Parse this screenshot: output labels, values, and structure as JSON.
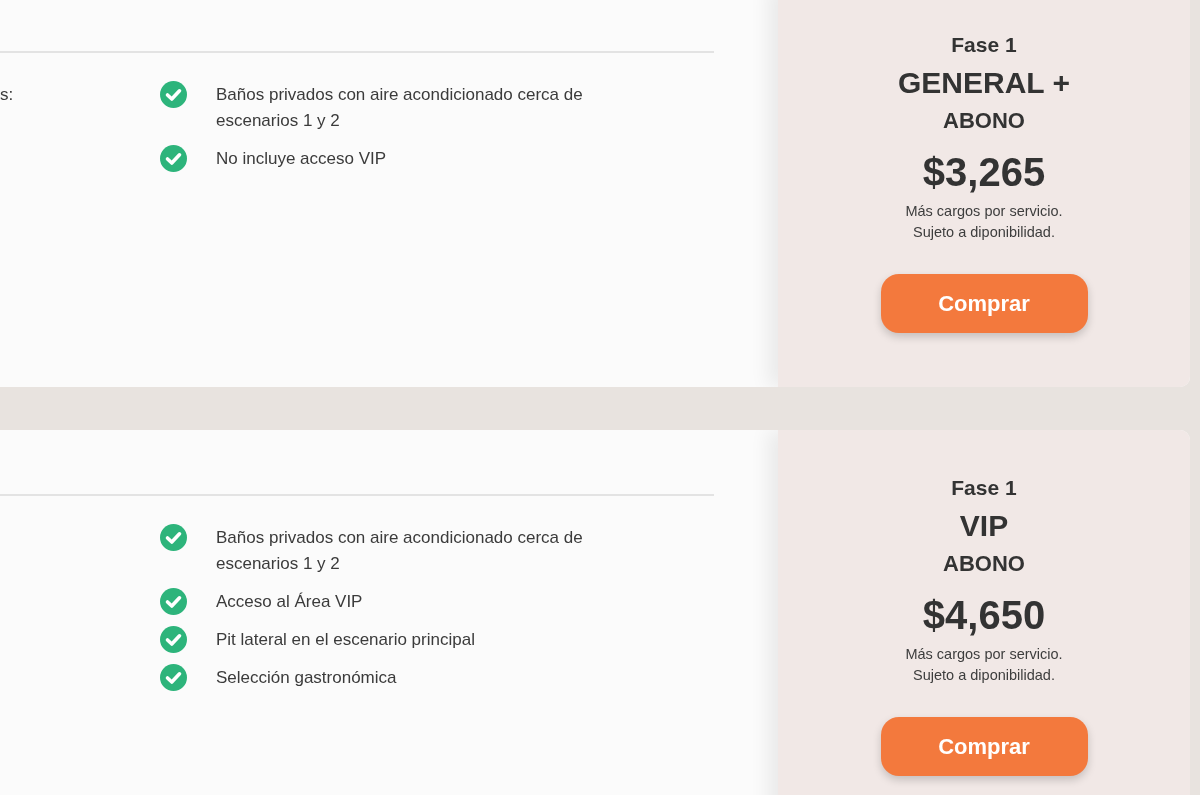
{
  "tickets": [
    {
      "benefits_label": "s:",
      "features": [
        "Baños privados con aire acondicionado cerca de escenarios 1 y 2",
        "No incluye acceso VIP"
      ],
      "phase": "Fase 1",
      "name": "GENERAL +",
      "type": "ABONO",
      "price": "$3,265",
      "notes": [
        "Más cargos por servicio.",
        "Sujeto a diponibilidad."
      ],
      "button": "Comprar"
    },
    {
      "features": [
        "Baños privados con aire acondicionado cerca de escenarios 1 y 2",
        "Acceso al Área VIP",
        "Pit lateral en el escenario principal",
        "Selección gastronómica"
      ],
      "phase": "Fase 1",
      "name": "VIP",
      "type": "ABONO",
      "price": "$4,650",
      "notes": [
        "Más cargos por servicio.",
        "Sujeto a diponibilidad."
      ],
      "button": "Comprar"
    }
  ]
}
